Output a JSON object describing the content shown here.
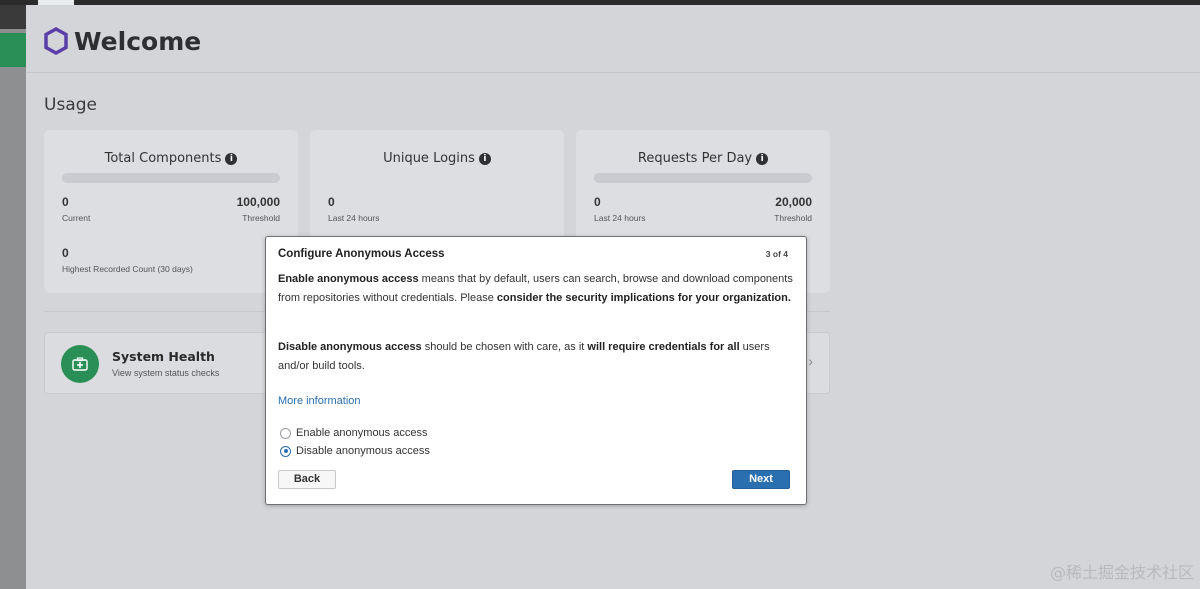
{
  "header": {
    "title": "Welcome"
  },
  "usage": {
    "section_title": "Usage",
    "cards": [
      {
        "title": "Total Components",
        "left_value": "0",
        "left_label": "Current",
        "right_value": "100,000",
        "right_label": "Threshold",
        "extra_value": "0",
        "extra_label": "Highest Recorded Count (30 days)"
      },
      {
        "title": "Unique Logins",
        "left_value": "0",
        "left_label": "Last 24 hours"
      },
      {
        "title": "Requests Per Day",
        "left_value": "0",
        "left_label": "Last 24 hours",
        "right_value": "20,000",
        "right_label": "Threshold"
      }
    ]
  },
  "system_health": {
    "title": "System Health",
    "subtitle": "View system status checks"
  },
  "modal": {
    "title": "Configure Anonymous Access",
    "step": "3 of 4",
    "p1_bold1": "Enable anonymous access",
    "p1_text1": " means that by default, users can search, browse and download components from repositories without credentials. Please ",
    "p1_bold2": "consider the security implications for your organization.",
    "p2_bold1": "Disable anonymous access",
    "p2_text1": " should be chosen with care, as it ",
    "p2_bold2": "will require credentials for all",
    "p2_text2": " users and/or build tools.",
    "more_link": "More information",
    "options": [
      "Enable anonymous access",
      "Disable anonymous access"
    ],
    "selected_option": "Disable anonymous access",
    "back_label": "Back",
    "next_label": "Next"
  },
  "watermark": "@稀土掘金技术社区",
  "colors": {
    "accent": "#2a6fb0",
    "health_green": "#2a8f56",
    "logo": "#5b3fa8"
  }
}
